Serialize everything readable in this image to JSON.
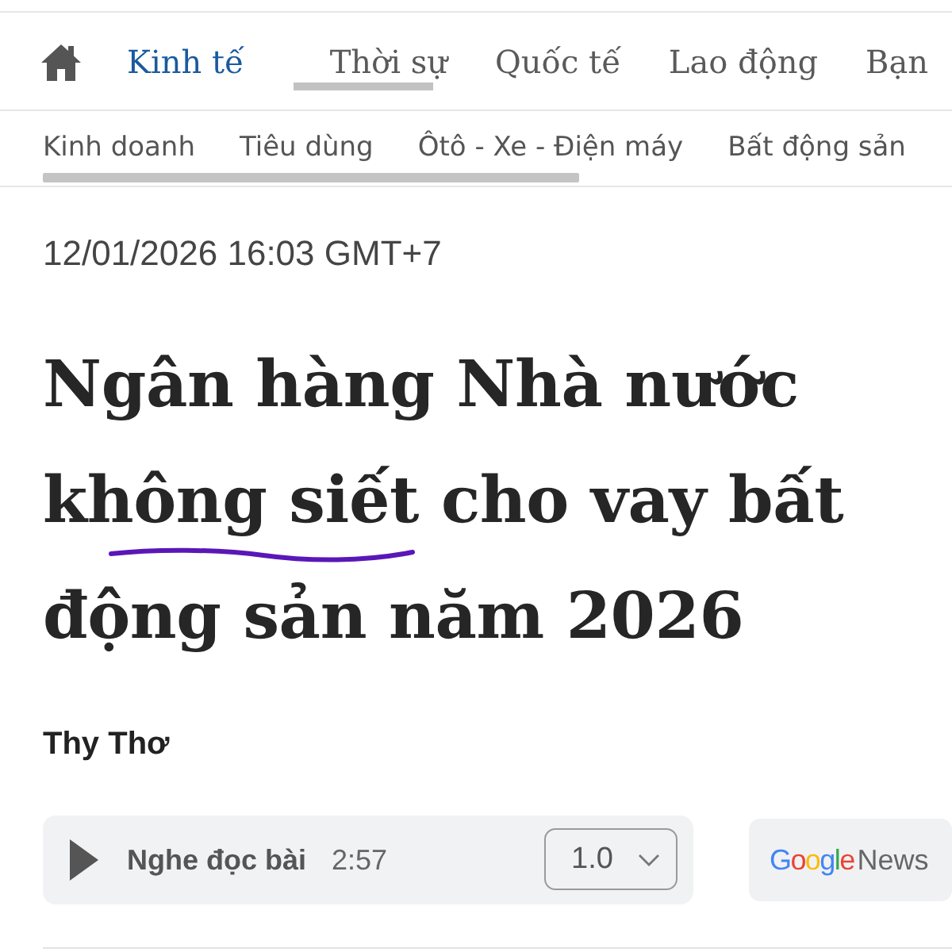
{
  "nav": {
    "items": [
      {
        "label": "Kinh tế",
        "selected": true
      },
      {
        "label": "Thời sự",
        "selected": false
      },
      {
        "label": "Quốc tế",
        "selected": false
      },
      {
        "label": "Lao động",
        "selected": false
      },
      {
        "label": "Bạn",
        "selected": false
      }
    ]
  },
  "subnav": {
    "items": [
      "Kinh doanh",
      "Tiêu dùng",
      "Ôtô - Xe - Điện máy",
      "Bất động sản"
    ]
  },
  "article": {
    "timestamp": "12/01/2026 16:03 GMT+7",
    "title": [
      {
        "text": "Ngân hàng Nhà nước ",
        "underlined": false
      },
      {
        "text": "không siết",
        "underlined": true
      },
      {
        "text": " cho vay bất động sản năm 2026",
        "underlined": false
      }
    ],
    "author": "Thy Thơ"
  },
  "audio_player": {
    "label": "Nghe đọc bài",
    "duration": "2:57",
    "speed": "1.0"
  },
  "google_news": {
    "brand": "Google",
    "label": "News"
  }
}
